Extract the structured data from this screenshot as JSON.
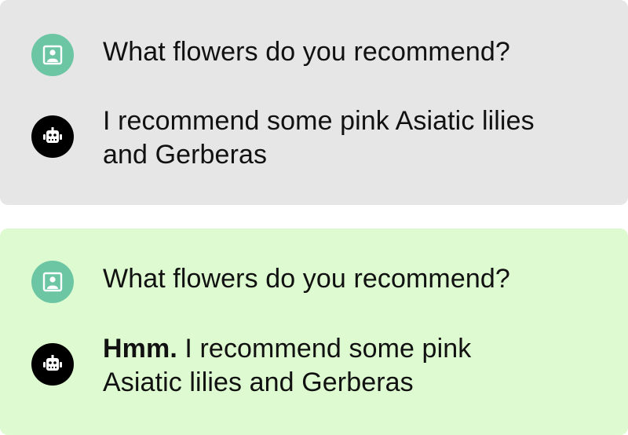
{
  "colors": {
    "top_panel_bg": "#e6e6e6",
    "bottom_panel_bg": "#ddfad0",
    "user_avatar_bg": "#6cc6a4",
    "bot_avatar_bg": "#000000",
    "text": "#111111"
  },
  "icons": {
    "user": "user-avatar-icon",
    "bot": "robot-avatar-icon"
  },
  "conversations": [
    {
      "user_message": "What flowers do you recommend?",
      "bot_prefix": "",
      "bot_message": "I recommend some pink Asiatic lilies and Gerberas"
    },
    {
      "user_message": "What flowers do you recommend?",
      "bot_prefix": "Hmm.",
      "bot_message": " I recommend some pink Asiatic lilies and Gerberas"
    }
  ]
}
